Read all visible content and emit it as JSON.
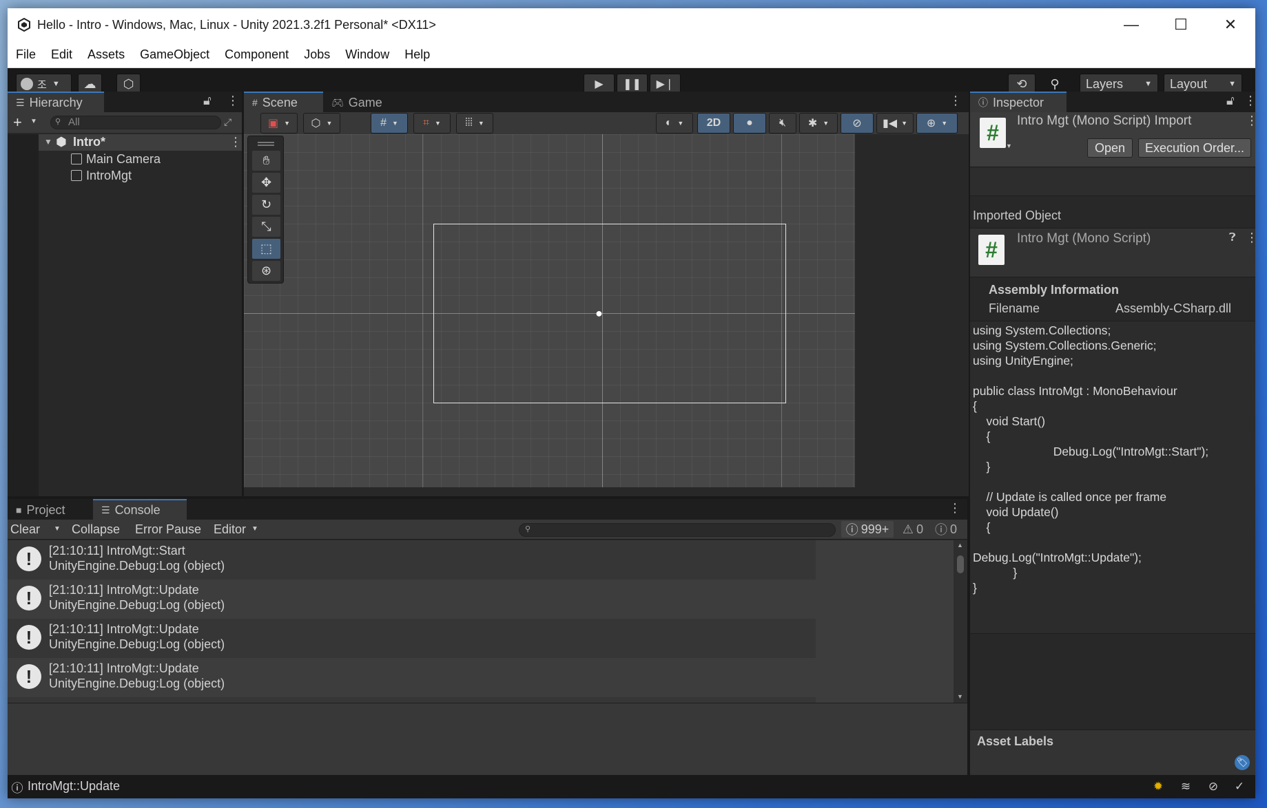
{
  "window": {
    "title": "Hello - Intro - Windows, Mac, Linux - Unity 2021.3.2f1 Personal* <DX11>",
    "minimize": "—",
    "maximize": "☐",
    "close": "✕"
  },
  "menu": {
    "items": [
      "File",
      "Edit",
      "Assets",
      "GameObject",
      "Component",
      "Jobs",
      "Window",
      "Help"
    ]
  },
  "toolbar": {
    "account_label": "조",
    "layers_label": "Layers",
    "layout_label": "Layout"
  },
  "hierarchy": {
    "tab_label": "Hierarchy",
    "search_placeholder": "All",
    "scene_name": "Intro*",
    "items": [
      "Main Camera",
      "IntroMgt"
    ]
  },
  "scene": {
    "tab_scene": "Scene",
    "tab_game": "Game",
    "mode_2d": "2D"
  },
  "bottom": {
    "tab_project": "Project",
    "tab_console": "Console"
  },
  "console": {
    "clear_label": "Clear",
    "collapse_label": "Collapse",
    "error_pause_label": "Error Pause",
    "editor_label": "Editor",
    "log_count": "999+",
    "warn_count": "0",
    "error_count": "0",
    "entries": [
      {
        "line1": "[21:10:11] IntroMgt::Start",
        "line2": "UnityEngine.Debug:Log (object)"
      },
      {
        "line1": "[21:10:11] IntroMgt::Update",
        "line2": "UnityEngine.Debug:Log (object)"
      },
      {
        "line1": "[21:10:11] IntroMgt::Update",
        "line2": "UnityEngine.Debug:Log (object)"
      },
      {
        "line1": "[21:10:11] IntroMgt::Update",
        "line2": "UnityEngine.Debug:Log (object)"
      }
    ]
  },
  "inspector": {
    "tab_label": "Inspector",
    "header_title": "Intro Mgt (Mono Script) Import",
    "open_label": "Open",
    "execution_order_label": "Execution Order...",
    "imported_object_label": "Imported Object",
    "object_title": "Intro Mgt (Mono Script)",
    "assembly_heading": "Assembly Information",
    "filename_label": "Filename",
    "filename_value": "Assembly-CSharp.dll",
    "code": "using System.Collections;\nusing System.Collections.Generic;\nusing UnityEngine;\n\npublic class IntroMgt : MonoBehaviour\n{\n    void Start()\n    {\n                        Debug.Log(\"IntroMgt::Start\");\n    }\n\n    // Update is called once per frame\n    void Update()\n    {\n\nDebug.Log(\"IntroMgt::Update\");\n            }\n}",
    "asset_labels_heading": "Asset Labels"
  },
  "status": {
    "message": "IntroMgt::Update"
  },
  "colors": {
    "accent": "#3a79bb",
    "selection": "#46607c",
    "script_icon": "#2e7d32"
  }
}
